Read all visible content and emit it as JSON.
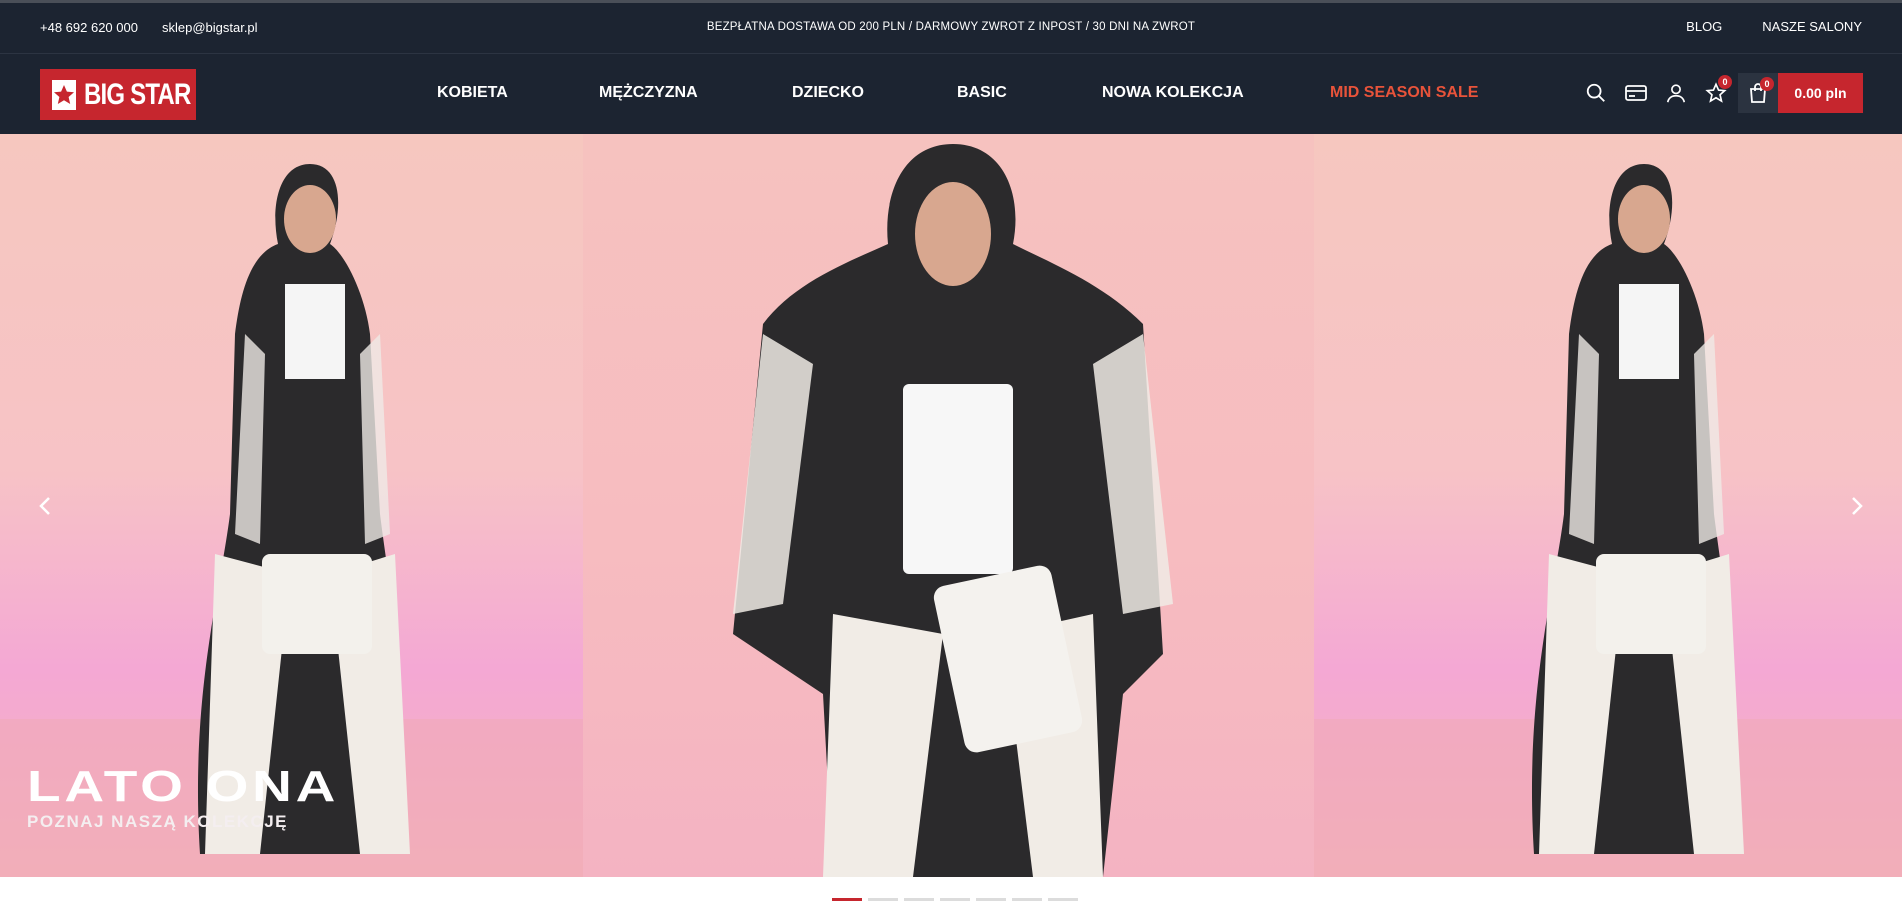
{
  "topbar": {
    "phone": "+48 692 620 000",
    "email": "sklep@bigstar.pl",
    "promo": "BEZPŁATNA DOSTAWA OD 200 PLN / DARMOWY ZWROT Z INPOST / 30 DNI NA ZWROT",
    "links": [
      "BLOG",
      "NASZE SALONY"
    ]
  },
  "header": {
    "logo_text": "BIG STAR",
    "menu": [
      "KOBIETA",
      "MĘŻCZYZNA",
      "DZIECKO",
      "BASIC",
      "NOWA KOLEKCJA",
      "MID SEASON SALE"
    ],
    "wishlist_count": "0",
    "cart_count": "0",
    "cart_total": "0.00 pln"
  },
  "hero": {
    "title": "LATO ONA",
    "subtitle": "POZNAJ NASZĄ KOLEKCJĘ",
    "slide_count": 7,
    "active_slide": 1
  },
  "colors": {
    "brand_red": "#c6262e",
    "header_bg": "#1c2431",
    "sale_orange": "#e8533a"
  },
  "icons": [
    "search-icon",
    "gift-card-icon",
    "user-icon",
    "star-icon",
    "shopping-bag-icon",
    "chevron-left-icon",
    "chevron-right-icon"
  ]
}
